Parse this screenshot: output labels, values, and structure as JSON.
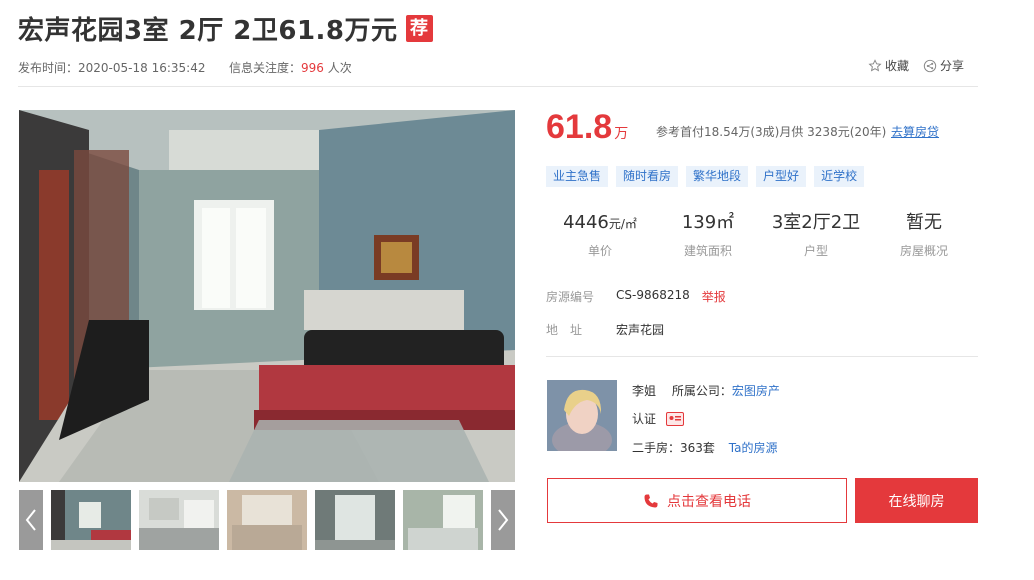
{
  "listing": {
    "title": "宏声花园3室 2厅 2卫61.8万元",
    "badge": "荐",
    "publish_label": "发布时间：",
    "publish_time": "2020-05-18 16:35:42",
    "attention_label": "信息关注度：",
    "attention_count": "996",
    "attention_suffix": "人次"
  },
  "actions": {
    "favorite": "收藏",
    "share": "分享",
    "favorite_icon": "star-outline-icon",
    "share_icon": "share-icon"
  },
  "gallery": {
    "main_photo": "living-room-photo",
    "thumbnails": [
      "living-room",
      "kitchen",
      "bedroom",
      "balcony-door",
      "bedroom-window"
    ],
    "prev_icon": "chevron-left-icon",
    "next_icon": "chevron-right-icon"
  },
  "price": {
    "value": "61.8",
    "unit": "万",
    "reference": "参考首付18.54万(3成)月供 3238元(20年)",
    "loan_link": "去算房贷"
  },
  "tags": [
    "业主急售",
    "随时看房",
    "繁华地段",
    "户型好",
    "近学校"
  ],
  "stats": [
    {
      "value": "4446",
      "unit": "元/㎡",
      "label": "单价"
    },
    {
      "value": "139㎡",
      "unit": "",
      "label": "建筑面积"
    },
    {
      "value": "3室2厅2卫",
      "unit": "",
      "label": "户型"
    },
    {
      "value": "暂无",
      "unit": "",
      "label": "房屋概况"
    }
  ],
  "details": {
    "id_label": "房源编号",
    "id_value": "CS-9868218",
    "report": "举报",
    "address_label": "地　址",
    "address_value": "宏声花园"
  },
  "agent": {
    "name": "李姐",
    "company_label": "所属公司：",
    "company": "宏图房产",
    "verify_label": "认证",
    "verify_icon": "id-card-icon",
    "listings_label": "二手房：",
    "listings_count": "363套",
    "listings_link": "Ta的房源"
  },
  "buttons": {
    "phone": "点击查看电话",
    "phone_icon": "phone-icon",
    "chat": "在线聊房"
  },
  "colors": {
    "accent_red": "#e4393c",
    "link_blue": "#3072c9",
    "tag_bg": "#eaf2fb"
  }
}
